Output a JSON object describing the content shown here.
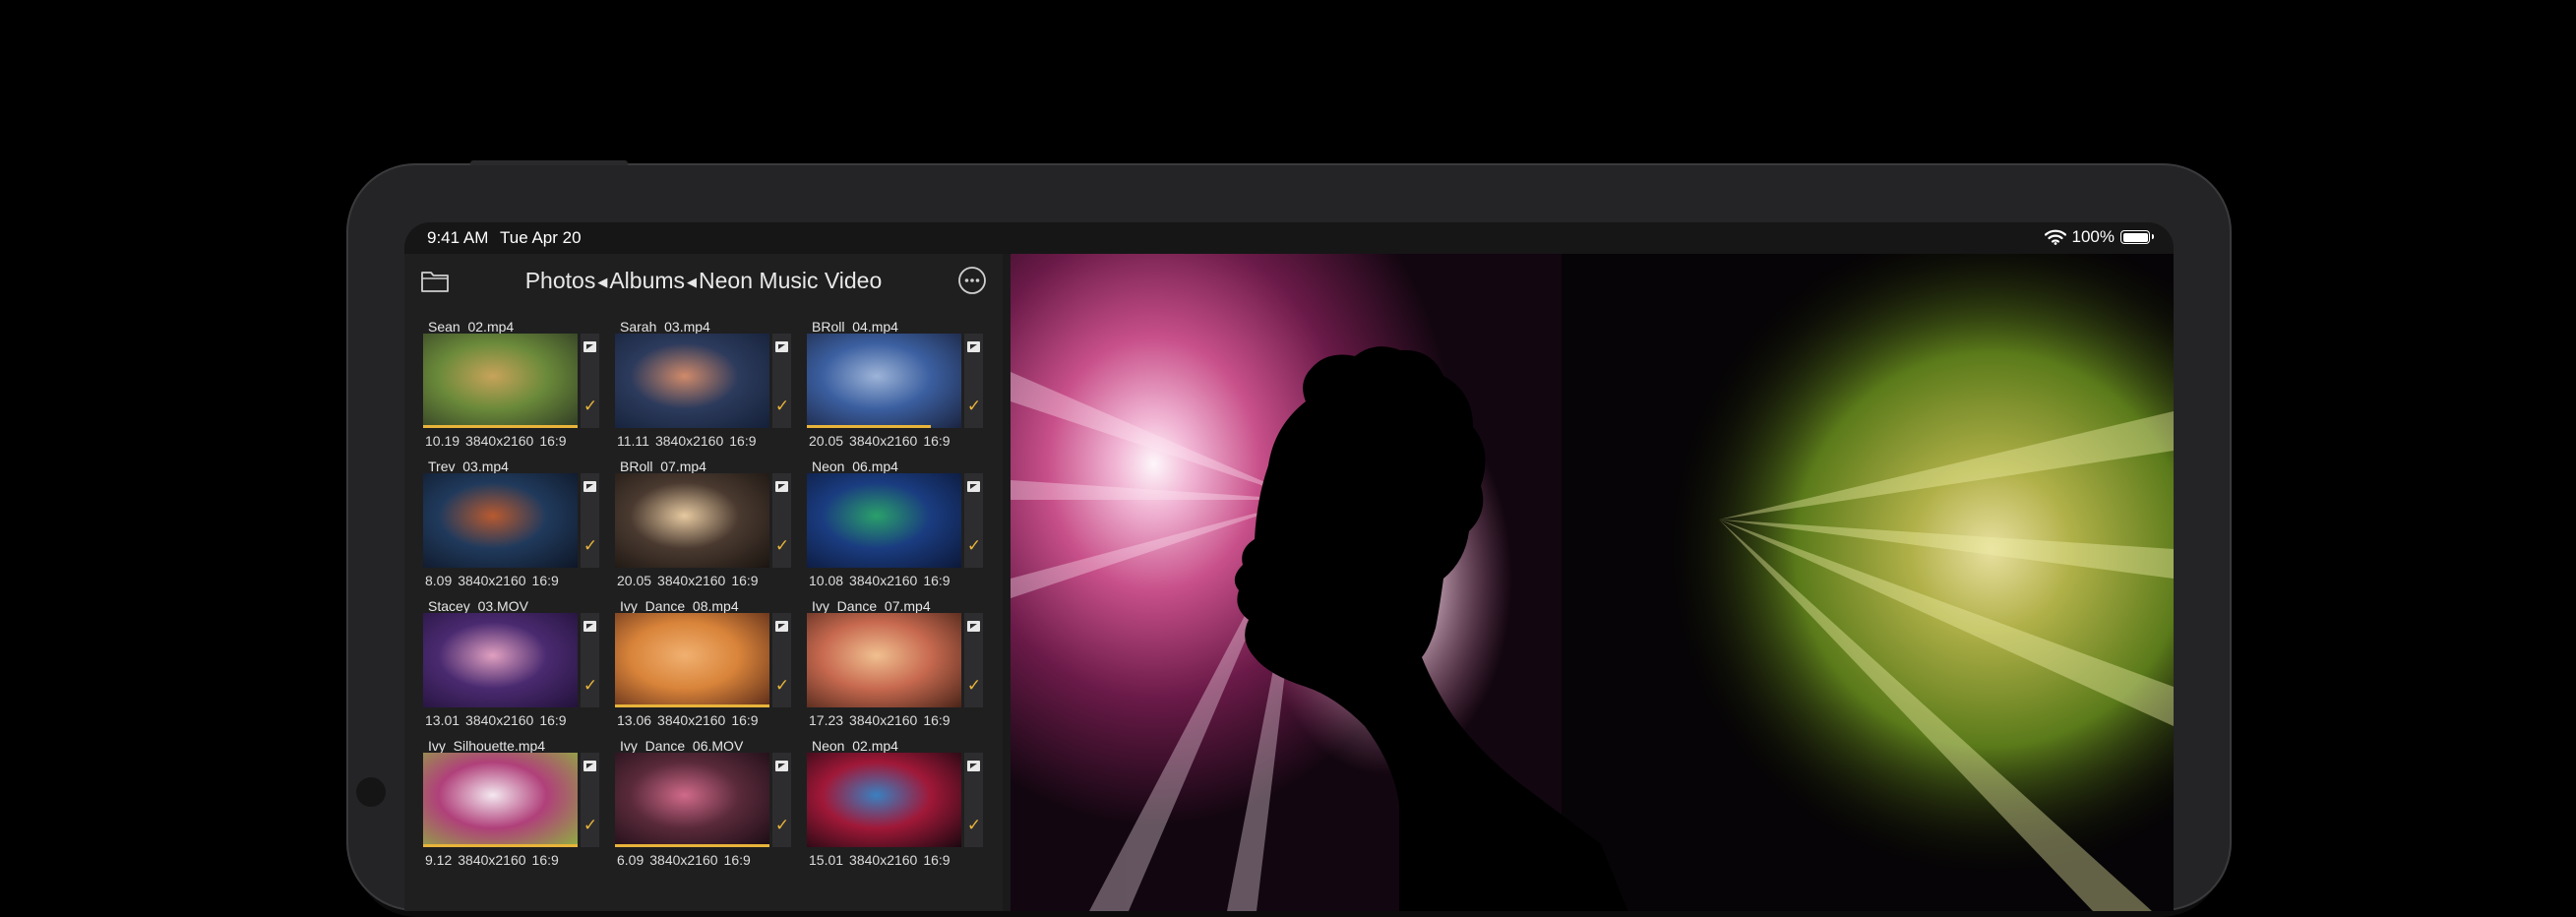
{
  "status_bar": {
    "time": "9:41 AM",
    "date": "Tue Apr 20",
    "battery": "100%"
  },
  "browser": {
    "breadcrumb": [
      "Photos",
      "Albums",
      "Neon Music Video"
    ],
    "accent_color": "#e8b43a",
    "clips": [
      {
        "name": "Sean_02.mp4",
        "duration": "10.19",
        "resolution": "3840x2160",
        "aspect": "16:9",
        "thumb_colors": [
          "#6b8a3a",
          "#c7a35a",
          "#2f3b24"
        ],
        "progress": 1.0
      },
      {
        "name": "Sarah_03.mp4",
        "duration": "11.11",
        "resolution": "3840x2160",
        "aspect": "16:9",
        "thumb_colors": [
          "#2c3a5c",
          "#d08a6a",
          "#142038"
        ],
        "progress": 0.0
      },
      {
        "name": "BRoll_04.mp4",
        "duration": "20.05",
        "resolution": "3840x2160",
        "aspect": "16:9",
        "thumb_colors": [
          "#3b5fa0",
          "#9db4d8",
          "#1b2440"
        ],
        "progress": 0.8
      },
      {
        "name": "Trev_03.mp4",
        "duration": "8.09",
        "resolution": "3840x2160",
        "aspect": "16:9",
        "thumb_colors": [
          "#203a5c",
          "#b85a30",
          "#0e1626"
        ],
        "progress": 0.0
      },
      {
        "name": "BRoll_07.mp4",
        "duration": "20.05",
        "resolution": "3840x2160",
        "aspect": "16:9",
        "thumb_colors": [
          "#4a3a30",
          "#e6c9a0",
          "#1a1410"
        ],
        "progress": 0.0
      },
      {
        "name": "Neon_06.mp4",
        "duration": "10.08",
        "resolution": "3840x2160",
        "aspect": "16:9",
        "thumb_colors": [
          "#1a3c80",
          "#2aa06a",
          "#0c1838"
        ],
        "progress": 0.0
      },
      {
        "name": "Stacey_03.MOV",
        "duration": "13.01",
        "resolution": "3840x2160",
        "aspect": "16:9",
        "thumb_colors": [
          "#4a2a70",
          "#e0a0c0",
          "#22123a"
        ],
        "progress": 0.0
      },
      {
        "name": "Ivy_Dance_08.mp4",
        "duration": "13.06",
        "resolution": "3840x2160",
        "aspect": "16:9",
        "thumb_colors": [
          "#d9843a",
          "#f0b070",
          "#5a2a18"
        ],
        "progress": 1.0
      },
      {
        "name": "Ivy_Dance_07.mp4",
        "duration": "17.23",
        "resolution": "3840x2160",
        "aspect": "16:9",
        "thumb_colors": [
          "#c86a50",
          "#f0c090",
          "#4a2418"
        ],
        "progress": 0.0
      },
      {
        "name": "Ivy_Silhouette.mp4",
        "duration": "9.12",
        "resolution": "3840x2160",
        "aspect": "16:9",
        "thumb_colors": [
          "#b0407a",
          "#f4e8f0",
          "#8fb040"
        ],
        "progress": 1.0
      },
      {
        "name": "Ivy_Dance_06.MOV",
        "duration": "6.09",
        "resolution": "3840x2160",
        "aspect": "16:9",
        "thumb_colors": [
          "#5a2a3a",
          "#d06a8a",
          "#1a0c14"
        ],
        "progress": 1.0
      },
      {
        "name": "Neon_02.mp4",
        "duration": "15.01",
        "resolution": "3840x2160",
        "aspect": "16:9",
        "thumb_colors": [
          "#a01838",
          "#3a80c0",
          "#1a0810"
        ],
        "progress": 0.0
      }
    ]
  },
  "viewer": {
    "palette": {
      "magenta": "#b0306e",
      "pink": "#e890c0",
      "white": "#f8eef4",
      "green": "#8aab3a",
      "yellow": "#d8d070"
    }
  },
  "icons": {
    "folder": "folder-icon",
    "more": "more-options-icon",
    "wifi": "wifi-icon",
    "battery": "battery-icon",
    "flag": "flag-icon",
    "check": "checkmark-icon"
  }
}
